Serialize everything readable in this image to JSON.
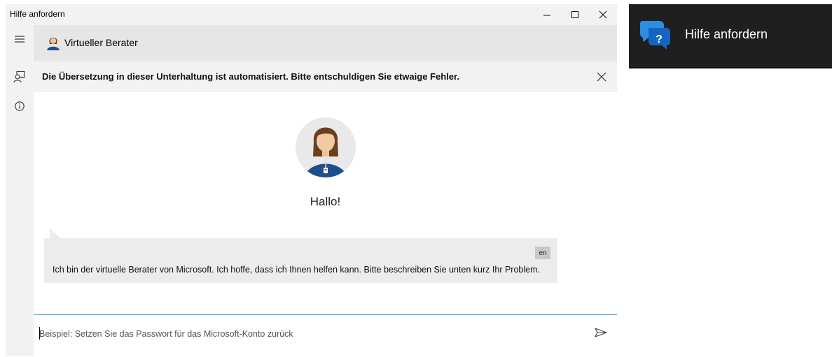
{
  "window": {
    "title": "Hilfe anfordern",
    "controls": {
      "minimize": "–",
      "maximize": "☐",
      "close": "✕"
    }
  },
  "header": {
    "title": "Virtueller Berater"
  },
  "banner": {
    "text": "Die Übersetzung in dieser Unterhaltung ist automatisiert. Bitte entschuldigen Sie etwaige Fehler."
  },
  "chat": {
    "greeting": "Hallo!",
    "message": {
      "lang": "en",
      "text": "Ich bin der virtuelle Berater von Microsoft. Ich hoffe, dass ich Ihnen helfen kann. Bitte beschreiben Sie unten kurz Ihr Problem."
    }
  },
  "input": {
    "placeholder": "Beispiel: Setzen Sie das Passwort für das Microsoft-Konto zurück",
    "value": ""
  },
  "taskbar": {
    "label": "Hilfe anfordern"
  },
  "colors": {
    "accent": "#4d9bd6",
    "icon_blue": "#1e88e5",
    "taskbar_bg": "#1f1f1f"
  }
}
